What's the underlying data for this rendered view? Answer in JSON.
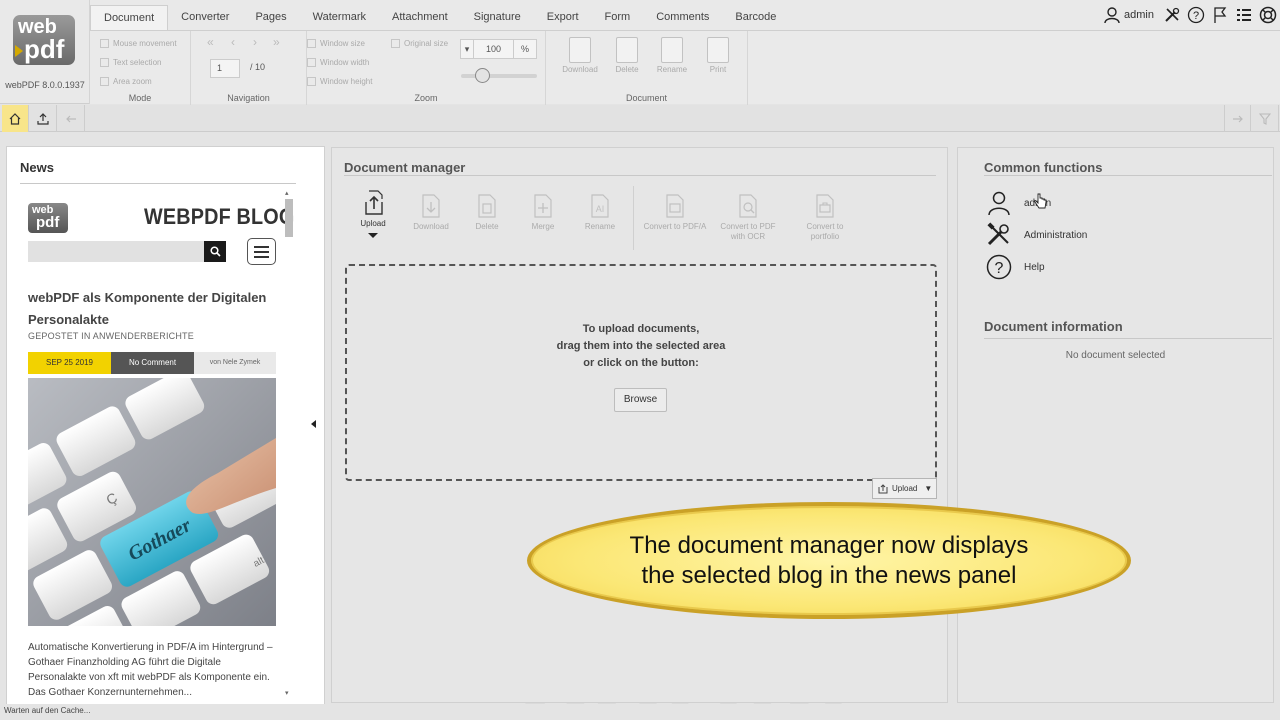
{
  "app": {
    "logo_top": "web",
    "logo_bottom": "pdf",
    "version": "webPDF 8.0.0.1937"
  },
  "tabs": [
    "Document",
    "Converter",
    "Pages",
    "Watermark",
    "Attachment",
    "Signature",
    "Export",
    "Form",
    "Comments",
    "Barcode"
  ],
  "ribbon": {
    "mode": {
      "label": "Mode",
      "items": [
        "Mouse movement",
        "Text selection",
        "Area zoom"
      ]
    },
    "navigation": {
      "label": "Navigation",
      "page": "1",
      "total": "/ 10"
    },
    "zoom": {
      "label": "Zoom",
      "items": [
        "Window size",
        "Window width",
        "Window height"
      ],
      "original": "Original size",
      "value": "100",
      "unit": "%"
    },
    "document": {
      "label": "Document",
      "items": [
        "Download",
        "Delete",
        "Rename",
        "Print"
      ]
    }
  },
  "user": {
    "name": "admin"
  },
  "news": {
    "title": "News",
    "blog_logo_top": "web",
    "blog_logo_bottom": "pdf",
    "blog_title": "WEBPDF BLOG",
    "post_title": "webPDF als Komponente der Digitalen Personalakte",
    "post_category": "GEPOSTET IN ANWENDERBERICHTE",
    "post_date": "SEP 25 2019",
    "post_comments": "No Comment",
    "post_author": "von Nele Zymek",
    "image_key_text": "Gothaer",
    "excerpt": "Automatische Konvertierung in PDF/A im Hintergrund – Gothaer Finanzholding AG führt die Digitale Personalakte von xft mit webPDF als Komponente ein. Das Gothaer Konzernunternehmen..."
  },
  "document_manager": {
    "title": "Document manager",
    "buttons": [
      "Upload",
      "Download",
      "Delete",
      "Merge",
      "Rename",
      "Convert to PDF/A",
      "Convert to PDF with OCR",
      "Convert to portfolio"
    ],
    "drop_text_1": "To upload documents,",
    "drop_text_2": "drag them into the selected area",
    "drop_text_3": "or click on the button:",
    "browse": "Browse",
    "upload_mini": "Upload"
  },
  "common_functions": {
    "title": "Common functions",
    "items": [
      "admin",
      "Administration",
      "Help"
    ]
  },
  "document_information": {
    "title": "Document information",
    "empty": "No document selected"
  },
  "callout": {
    "line1": "The document manager now displays",
    "line2": "the selected blog in the news panel"
  },
  "status": "Warten auf den Cache...",
  "colors": {
    "home_button": "#f8e58a",
    "callout_fill": "#fbe775",
    "callout_border": "#caa127",
    "date_badge": "#f2d200"
  }
}
